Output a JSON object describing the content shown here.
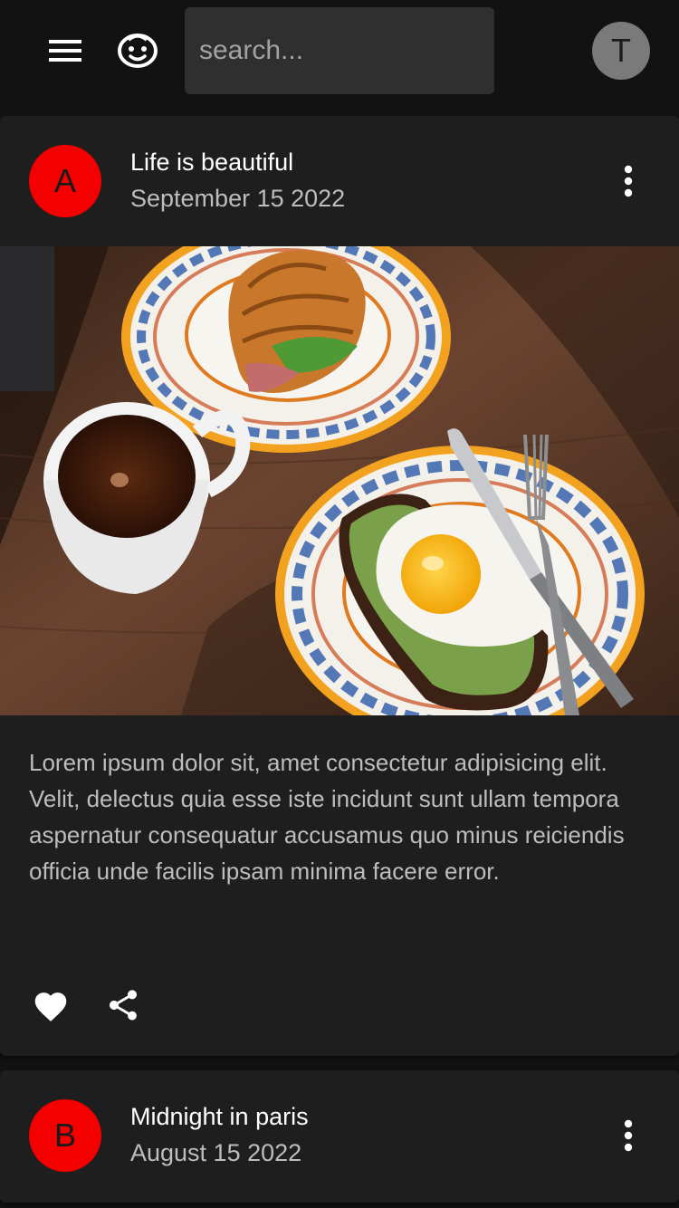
{
  "appbar": {
    "search_placeholder": "search...",
    "user_initial": "T",
    "menu_icon": "hamburger-menu-icon",
    "logo_icon": "smiley-face-icon"
  },
  "posts": [
    {
      "avatar_letter": "A",
      "avatar_color": "#f40000",
      "title": "Life is beautiful",
      "date": "September 15 2022",
      "image": "breakfast-photo",
      "body": "Lorem ipsum dolor sit, amet consectetur adipisicing elit. Velit, delectus quia esse iste incidunt sunt ullam tempora aspernatur consequatur accusamus quo minus reiciendis officia unde facilis ipsam minima facere error.",
      "actions": [
        "heart-icon",
        "share-icon"
      ]
    },
    {
      "avatar_letter": "B",
      "avatar_color": "#f40000",
      "title": "Midnight in paris",
      "date": "August 15 2022"
    }
  ],
  "colors": {
    "background": "#121212",
    "card": "#1e1e1e",
    "search_bg": "#2f2f2f",
    "avatar_red": "#f40000",
    "user_avatar": "#7a7a7a",
    "text_primary": "#ffffff",
    "text_secondary": "#bdbdbd"
  }
}
